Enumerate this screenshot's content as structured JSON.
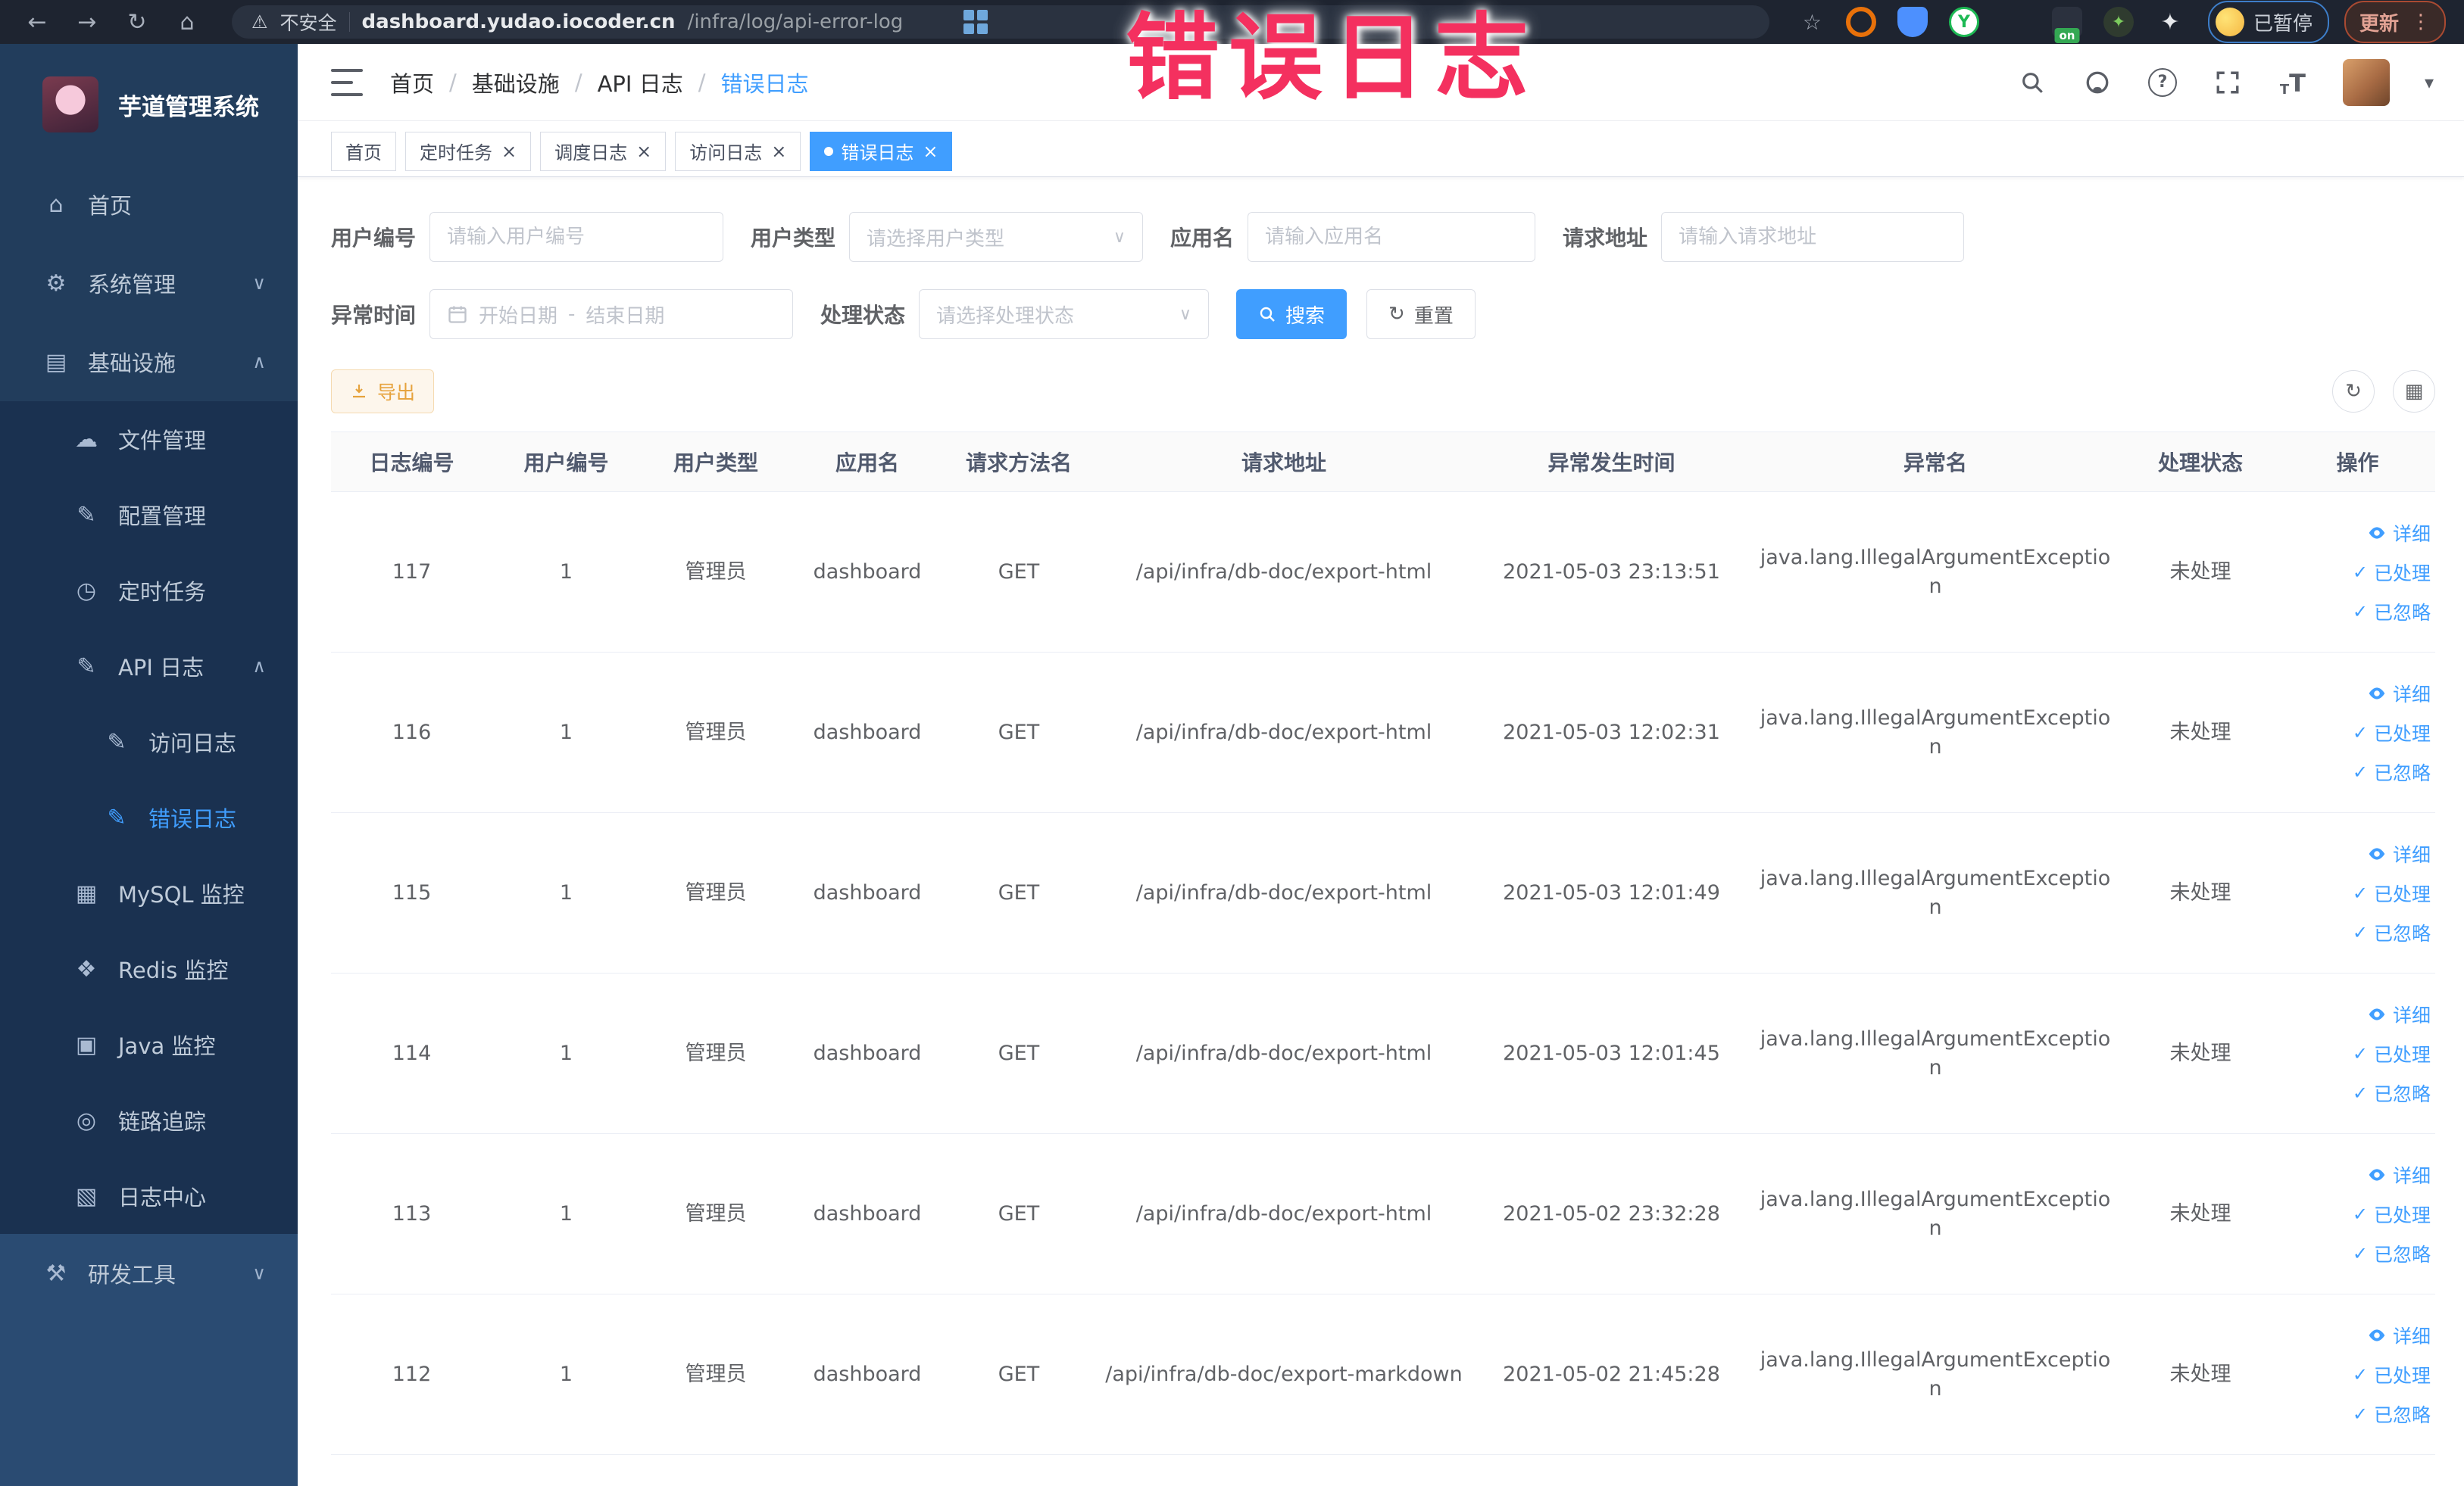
{
  "colors": {
    "accent": "#409EFF",
    "annotation": "#F4305F",
    "warning": "#E6A23C",
    "sidebar_bg": "#223D5C",
    "submenu_bg": "#1A3150",
    "sidebar_bottom_bg": "#2A4B72"
  },
  "icon_glyphs": {
    "back-icon": "←",
    "forward-icon": "→",
    "reload-icon": "↻",
    "home-glyph-icon": "⌂",
    "star-icon": "☆",
    "warning-icon": "⚠",
    "dots-icon": "⋮",
    "home-icon": "⌂",
    "gear-icon": "⚙",
    "monitor-icon": "▤",
    "cloud-icon": "☁",
    "edit-icon": "✎",
    "timer-icon": "◷",
    "log-icon": "✎",
    "mysql-icon": "▦",
    "redis-icon": "❖",
    "java-icon": "▣",
    "trace-icon": "◎",
    "log-center-icon": "▧",
    "tools-icon": "⚒",
    "chevron-up-icon": "∧",
    "chevron-down-icon": "∨",
    "close-icon": "×",
    "check-icon": "✓",
    "caret-down-icon": "▾",
    "question-icon": "?",
    "font-size-icon": "T",
    "pinwheel-icon": "✦",
    "y-icon": "Y",
    "refresh-icon": "↻",
    "columns-icon": "▦",
    "date-separator": "-"
  },
  "browser": {
    "security_label": "不安全",
    "url_domain": "dashboard.yudao.iocoder.cn",
    "url_path": "/infra/log/api-error-log",
    "on_badge": "on",
    "paused_label": "已暂停",
    "update_label": "更新"
  },
  "annotation": {
    "text": "错误日志"
  },
  "sidebar": {
    "title": "芋道管理系统",
    "items": [
      {
        "name": "home",
        "label": "首页",
        "icon": "home-icon",
        "level": 1,
        "section": "top",
        "arrow": null,
        "active": false
      },
      {
        "name": "system",
        "label": "系统管理",
        "icon": "gear-icon",
        "level": 1,
        "section": "top",
        "arrow": "down",
        "active": false
      },
      {
        "name": "infra",
        "label": "基础设施",
        "icon": "monitor-icon",
        "level": 1,
        "section": "top",
        "arrow": "up",
        "active": false
      },
      {
        "name": "file-manage",
        "label": "文件管理",
        "icon": "cloud-icon",
        "level": 2,
        "section": "sub",
        "arrow": null,
        "active": false
      },
      {
        "name": "config-manage",
        "label": "配置管理",
        "icon": "edit-icon",
        "level": 2,
        "section": "sub",
        "arrow": null,
        "active": false
      },
      {
        "name": "scheduled-jobs",
        "label": "定时任务",
        "icon": "timer-icon",
        "level": 2,
        "section": "sub",
        "arrow": null,
        "active": false
      },
      {
        "name": "api-log",
        "label": "API 日志",
        "icon": "log-icon",
        "level": 2,
        "section": "sub",
        "arrow": "up",
        "active": false
      },
      {
        "name": "access-log",
        "label": "访问日志",
        "icon": "log-icon",
        "level": 3,
        "section": "sub",
        "arrow": null,
        "active": false
      },
      {
        "name": "error-log",
        "label": "错误日志",
        "icon": "log-icon",
        "level": 3,
        "section": "sub",
        "arrow": null,
        "active": true
      },
      {
        "name": "mysql-monitor",
        "label": "MySQL 监控",
        "icon": "mysql-icon",
        "level": 2,
        "section": "sub",
        "arrow": null,
        "active": false
      },
      {
        "name": "redis-monitor",
        "label": "Redis 监控",
        "icon": "redis-icon",
        "level": 2,
        "section": "sub",
        "arrow": null,
        "active": false
      },
      {
        "name": "java-monitor",
        "label": "Java 监控",
        "icon": "java-icon",
        "level": 2,
        "section": "sub",
        "arrow": null,
        "active": false
      },
      {
        "name": "trace",
        "label": "链路追踪",
        "icon": "trace-icon",
        "level": 2,
        "section": "sub",
        "arrow": null,
        "active": false
      },
      {
        "name": "log-center",
        "label": "日志中心",
        "icon": "log-center-icon",
        "level": 2,
        "section": "sub",
        "arrow": null,
        "active": false
      },
      {
        "name": "dev-tools",
        "label": "研发工具",
        "icon": "tools-icon",
        "level": 1,
        "section": "bottom",
        "arrow": "down",
        "active": false
      }
    ]
  },
  "header": {
    "breadcrumb": {
      "items": [
        "首页",
        "基础设施",
        "API 日志",
        "错误日志"
      ],
      "separator": "/"
    }
  },
  "tabs": {
    "items": [
      {
        "label": "首页",
        "closable": false,
        "active": false
      },
      {
        "label": "定时任务",
        "closable": true,
        "active": false
      },
      {
        "label": "调度日志",
        "closable": true,
        "active": false
      },
      {
        "label": "访问日志",
        "closable": true,
        "active": false
      },
      {
        "label": "错误日志",
        "closable": true,
        "active": true
      }
    ]
  },
  "filters": {
    "user_id": {
      "label": "用户编号",
      "placeholder": "请输入用户编号"
    },
    "user_type": {
      "label": "用户类型",
      "placeholder": "请选择用户类型"
    },
    "app_name": {
      "label": "应用名",
      "placeholder": "请输入应用名"
    },
    "request_url": {
      "label": "请求地址",
      "placeholder": "请输入请求地址"
    },
    "error_time": {
      "label": "异常时间",
      "start_placeholder": "开始日期",
      "end_placeholder": "结束日期"
    },
    "status": {
      "label": "处理状态",
      "placeholder": "请选择处理状态"
    },
    "search_label": "搜索",
    "reset_label": "重置",
    "export_label": "导出"
  },
  "table": {
    "columns": [
      "日志编号",
      "用户编号",
      "用户类型",
      "应用名",
      "请求方法名",
      "请求地址",
      "异常发生时间",
      "异常名",
      "处理状态",
      "操作"
    ],
    "row_actions": [
      "详细",
      "已处理",
      "已忽略"
    ],
    "rows": [
      {
        "log_id": "117",
        "user_id": "1",
        "user_type": "管理员",
        "app": "dashboard",
        "method": "GET",
        "url": "/api/infra/db-doc/export-html",
        "time": "2021-05-03 23:13:51",
        "exception": "java.lang.IllegalArgumentException",
        "status": "未处理"
      },
      {
        "log_id": "116",
        "user_id": "1",
        "user_type": "管理员",
        "app": "dashboard",
        "method": "GET",
        "url": "/api/infra/db-doc/export-html",
        "time": "2021-05-03 12:02:31",
        "exception": "java.lang.IllegalArgumentException",
        "status": "未处理"
      },
      {
        "log_id": "115",
        "user_id": "1",
        "user_type": "管理员",
        "app": "dashboard",
        "method": "GET",
        "url": "/api/infra/db-doc/export-html",
        "time": "2021-05-03 12:01:49",
        "exception": "java.lang.IllegalArgumentException",
        "status": "未处理"
      },
      {
        "log_id": "114",
        "user_id": "1",
        "user_type": "管理员",
        "app": "dashboard",
        "method": "GET",
        "url": "/api/infra/db-doc/export-html",
        "time": "2021-05-03 12:01:45",
        "exception": "java.lang.IllegalArgumentException",
        "status": "未处理"
      },
      {
        "log_id": "113",
        "user_id": "1",
        "user_type": "管理员",
        "app": "dashboard",
        "method": "GET",
        "url": "/api/infra/db-doc/export-html",
        "time": "2021-05-02 23:32:28",
        "exception": "java.lang.IllegalArgumentException",
        "status": "未处理"
      },
      {
        "log_id": "112",
        "user_id": "1",
        "user_type": "管理员",
        "app": "dashboard",
        "method": "GET",
        "url": "/api/infra/db-doc/export-markdown",
        "time": "2021-05-02 21:45:28",
        "exception": "java.lang.IllegalArgumentException",
        "status": "未处理"
      }
    ]
  }
}
